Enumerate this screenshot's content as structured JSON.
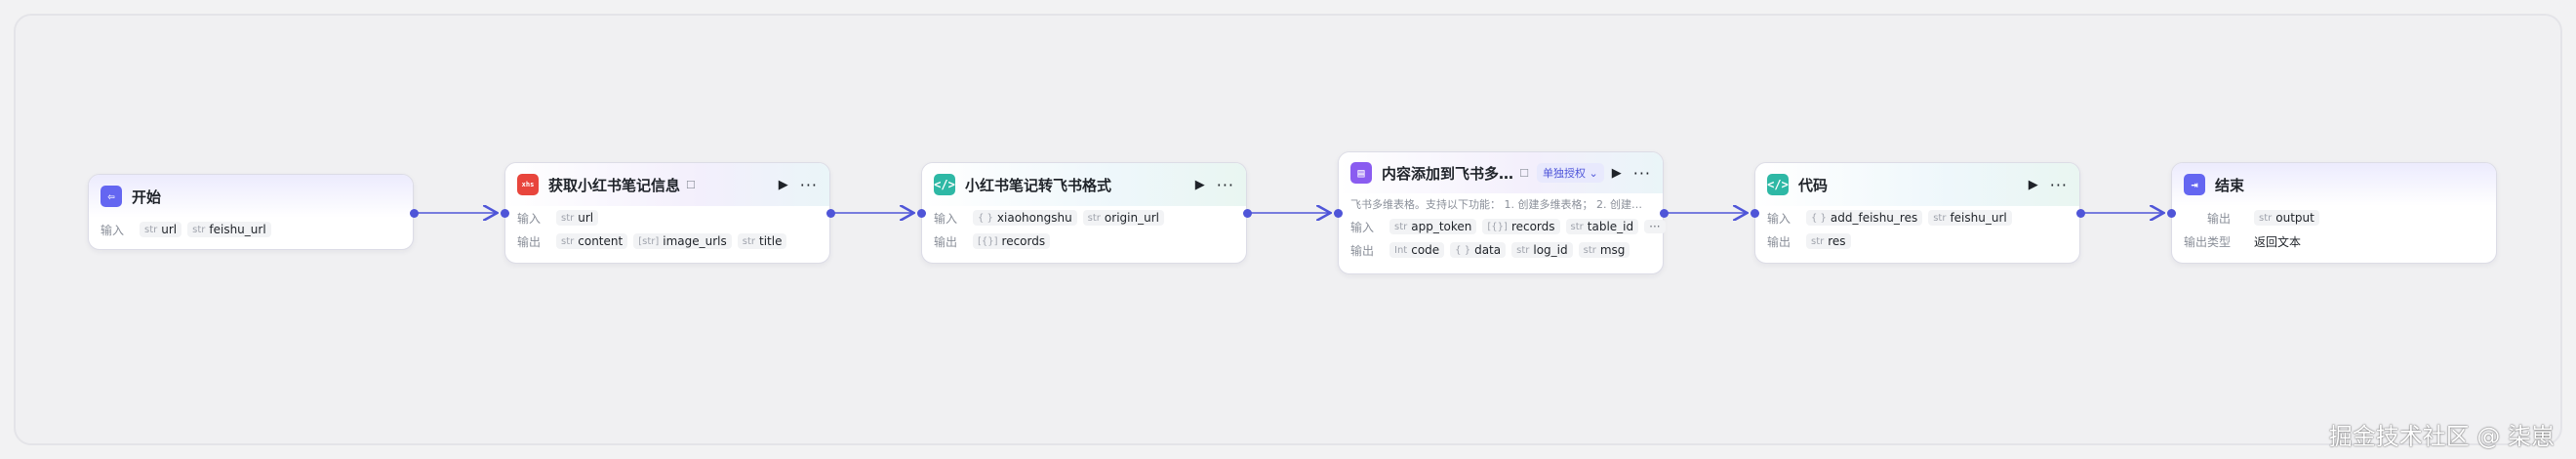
{
  "nodes": {
    "start": {
      "title": "开始",
      "input_label": "输入",
      "inputs": [
        {
          "type": "str",
          "name": "url"
        },
        {
          "type": "str",
          "name": "feishu_url"
        }
      ]
    },
    "fetch": {
      "title": "获取小红书笔记信息",
      "input_label": "输入",
      "output_label": "输出",
      "inputs": [
        {
          "type": "str",
          "name": "url"
        }
      ],
      "outputs": [
        {
          "type": "str",
          "name": "content"
        },
        {
          "type": "[str]",
          "name": "image_urls"
        },
        {
          "type": "str",
          "name": "title"
        }
      ]
    },
    "convert": {
      "title": "小红书笔记转飞书格式",
      "input_label": "输入",
      "output_label": "输出",
      "inputs": [
        {
          "type": "{ }",
          "name": "xiaohongshu"
        },
        {
          "type": "str",
          "name": "origin_url"
        }
      ],
      "outputs": [
        {
          "type": "[{}]",
          "name": "records"
        }
      ]
    },
    "add": {
      "title": "内容添加到飞书多...",
      "auth": "单独授权 ⌄",
      "description": "飞书多维表格。支持以下功能： 1. 创建多维表格； 2. 创建多...",
      "input_label": "输入",
      "output_label": "输出",
      "more_label": "···",
      "inputs": [
        {
          "type": "str",
          "name": "app_token"
        },
        {
          "type": "[{}]",
          "name": "records"
        },
        {
          "type": "str",
          "name": "table_id"
        }
      ],
      "outputs": [
        {
          "type": "Int",
          "name": "code"
        },
        {
          "type": "{ }",
          "name": "data"
        },
        {
          "type": "str",
          "name": "log_id"
        },
        {
          "type": "str",
          "name": "msg"
        }
      ]
    },
    "code": {
      "title": "代码",
      "input_label": "输入",
      "output_label": "输出",
      "inputs": [
        {
          "type": "{ }",
          "name": "add_feishu_res"
        },
        {
          "type": "str",
          "name": "feishu_url"
        }
      ],
      "outputs": [
        {
          "type": "str",
          "name": "res"
        }
      ]
    },
    "end": {
      "title": "结束",
      "output_label": "输出",
      "output_type_label": "输出类型",
      "outputs": [
        {
          "type": "str",
          "name": "output"
        }
      ],
      "output_type": "返回文本"
    }
  },
  "watermark": "掘金技术社区 @ 柒崽",
  "colors": {
    "accent": "#4f55d8",
    "node_border": "#dcdce6",
    "canvas": "#f0f0f2"
  }
}
